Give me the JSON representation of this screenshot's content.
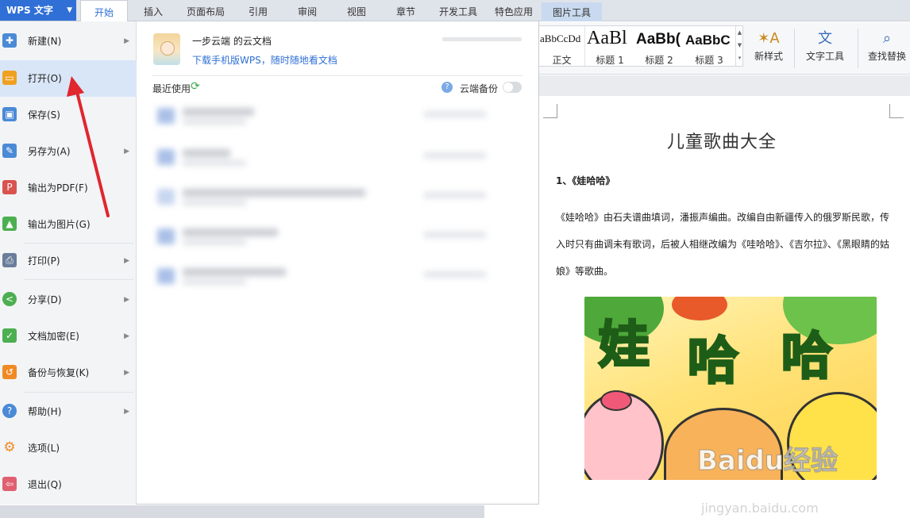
{
  "app": {
    "button_label": "WPS 文字",
    "accent": "#2f6fd6"
  },
  "tabs": [
    {
      "label": "开始",
      "active": true
    },
    {
      "label": "插入"
    },
    {
      "label": "页面布局"
    },
    {
      "label": "引用"
    },
    {
      "label": "审阅"
    },
    {
      "label": "视图"
    },
    {
      "label": "章节"
    },
    {
      "label": "开发工具"
    },
    {
      "label": "特色应用"
    },
    {
      "label": "图片工具",
      "contextual": true
    }
  ],
  "ribbon": {
    "styles": [
      {
        "preview": "aBbCcDd",
        "label": "正文"
      },
      {
        "preview": "AaBl",
        "label": "标题 1"
      },
      {
        "preview": "AaBb(",
        "label": "标题 2"
      },
      {
        "preview": "AaBbC",
        "label": "标题 3"
      }
    ],
    "new_style": {
      "label": "新样式",
      "icon": "new-style-icon"
    },
    "text_tools": {
      "label": "文字工具",
      "icon": "text-tools-icon"
    },
    "find_replace": {
      "label": "查找替换",
      "icon": "find-replace-icon"
    }
  },
  "file_menu": {
    "items": [
      {
        "label": "新建(N)",
        "icon": "new-document-icon",
        "color": "#4a8ad6",
        "submenu": true
      },
      {
        "label": "打开(O)",
        "icon": "open-folder-icon",
        "color": "#f0a020",
        "submenu": false,
        "selected": true
      },
      {
        "label": "保存(S)",
        "icon": "save-icon",
        "color": "#4a8ad6",
        "submenu": false
      },
      {
        "label": "另存为(A)",
        "icon": "save-as-icon",
        "color": "#4a8ad6",
        "submenu": true
      },
      {
        "label": "输出为PDF(F)",
        "icon": "export-pdf-icon",
        "color": "#d9534f",
        "submenu": false
      },
      {
        "label": "输出为图片(G)",
        "icon": "export-image-icon",
        "color": "#4caf50",
        "submenu": false
      },
      {
        "label": "打印(P)",
        "icon": "print-icon",
        "color": "#6a7d9a",
        "submenu": true
      },
      {
        "label": "分享(D)",
        "icon": "share-icon",
        "color": "#4caf50",
        "submenu": true
      },
      {
        "label": "文档加密(E)",
        "icon": "encrypt-icon",
        "color": "#4caf50",
        "submenu": true
      },
      {
        "label": "备份与恢复(K)",
        "icon": "backup-icon",
        "color": "#f08a24",
        "submenu": true
      },
      {
        "label": "帮助(H)",
        "icon": "help-icon",
        "color": "#4a8ad6",
        "submenu": true
      },
      {
        "label": "选项(L)",
        "icon": "options-gear-icon",
        "color": "#f08a24",
        "submenu": false
      },
      {
        "label": "退出(Q)",
        "icon": "exit-icon",
        "color": "#e06070",
        "submenu": false
      }
    ]
  },
  "panel": {
    "cloud_title": "一步云端 的云文档",
    "cloud_link": "下载手机版WPS，随时随地看文档",
    "progress_fraction": 0.0,
    "recent_label": "最近使用",
    "cloud_backup_label": "云端备份",
    "cloud_backup_on": false
  },
  "document": {
    "title": "儿童歌曲大全",
    "heading": "1、《娃哈哈》",
    "paragraph": "《娃哈哈》由石夫谱曲填词，潘振声编曲。改编自由新疆传入的俄罗斯民歌，传入时只有曲调未有歌词，后被人相继改编为《哇哈哈》、《吉尔拉》、《黑眼睛的姑娘》等歌曲。",
    "image_text": [
      "娃",
      "哈",
      "哈"
    ],
    "watermark": "Baidu经验",
    "watermark_url": "jingyan.baidu.com"
  }
}
